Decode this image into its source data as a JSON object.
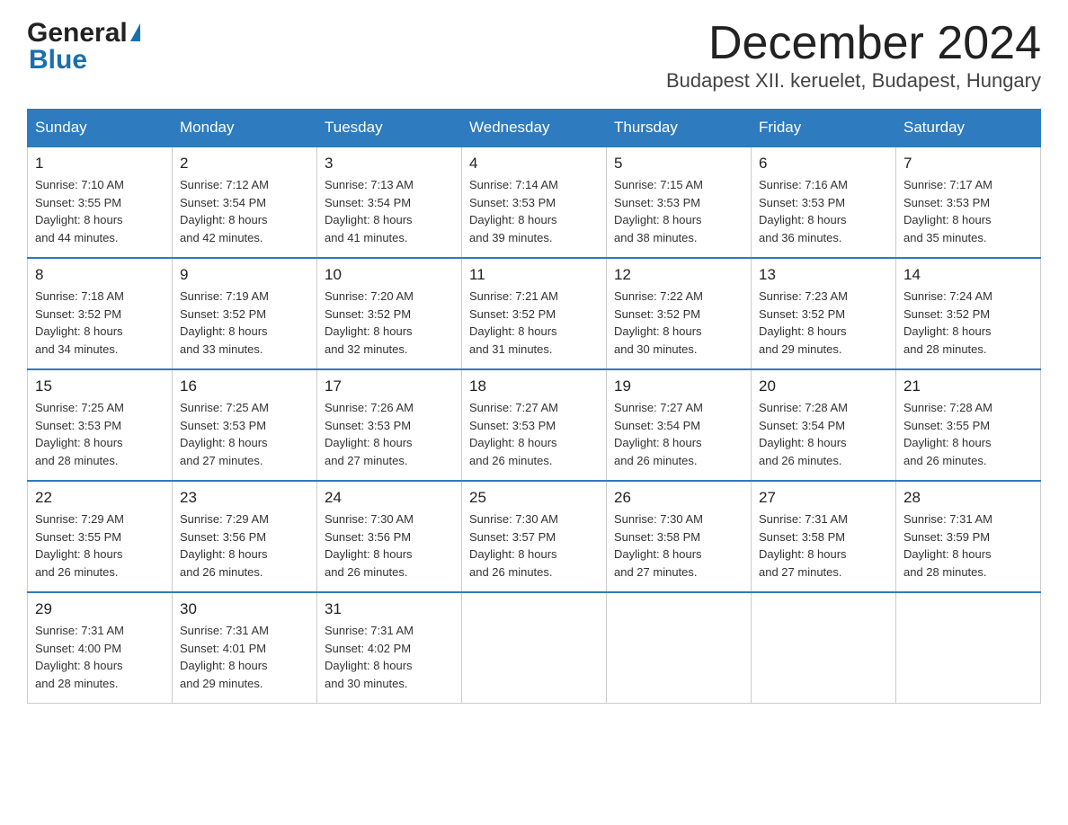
{
  "header": {
    "logo_general": "General",
    "logo_blue": "Blue",
    "month_title": "December 2024",
    "location": "Budapest XII. keruelet, Budapest, Hungary"
  },
  "days_of_week": [
    "Sunday",
    "Monday",
    "Tuesday",
    "Wednesday",
    "Thursday",
    "Friday",
    "Saturday"
  ],
  "weeks": [
    [
      {
        "num": "1",
        "sunrise": "7:10 AM",
        "sunset": "3:55 PM",
        "daylight": "8 hours and 44 minutes."
      },
      {
        "num": "2",
        "sunrise": "7:12 AM",
        "sunset": "3:54 PM",
        "daylight": "8 hours and 42 minutes."
      },
      {
        "num": "3",
        "sunrise": "7:13 AM",
        "sunset": "3:54 PM",
        "daylight": "8 hours and 41 minutes."
      },
      {
        "num": "4",
        "sunrise": "7:14 AM",
        "sunset": "3:53 PM",
        "daylight": "8 hours and 39 minutes."
      },
      {
        "num": "5",
        "sunrise": "7:15 AM",
        "sunset": "3:53 PM",
        "daylight": "8 hours and 38 minutes."
      },
      {
        "num": "6",
        "sunrise": "7:16 AM",
        "sunset": "3:53 PM",
        "daylight": "8 hours and 36 minutes."
      },
      {
        "num": "7",
        "sunrise": "7:17 AM",
        "sunset": "3:53 PM",
        "daylight": "8 hours and 35 minutes."
      }
    ],
    [
      {
        "num": "8",
        "sunrise": "7:18 AM",
        "sunset": "3:52 PM",
        "daylight": "8 hours and 34 minutes."
      },
      {
        "num": "9",
        "sunrise": "7:19 AM",
        "sunset": "3:52 PM",
        "daylight": "8 hours and 33 minutes."
      },
      {
        "num": "10",
        "sunrise": "7:20 AM",
        "sunset": "3:52 PM",
        "daylight": "8 hours and 32 minutes."
      },
      {
        "num": "11",
        "sunrise": "7:21 AM",
        "sunset": "3:52 PM",
        "daylight": "8 hours and 31 minutes."
      },
      {
        "num": "12",
        "sunrise": "7:22 AM",
        "sunset": "3:52 PM",
        "daylight": "8 hours and 30 minutes."
      },
      {
        "num": "13",
        "sunrise": "7:23 AM",
        "sunset": "3:52 PM",
        "daylight": "8 hours and 29 minutes."
      },
      {
        "num": "14",
        "sunrise": "7:24 AM",
        "sunset": "3:52 PM",
        "daylight": "8 hours and 28 minutes."
      }
    ],
    [
      {
        "num": "15",
        "sunrise": "7:25 AM",
        "sunset": "3:53 PM",
        "daylight": "8 hours and 28 minutes."
      },
      {
        "num": "16",
        "sunrise": "7:25 AM",
        "sunset": "3:53 PM",
        "daylight": "8 hours and 27 minutes."
      },
      {
        "num": "17",
        "sunrise": "7:26 AM",
        "sunset": "3:53 PM",
        "daylight": "8 hours and 27 minutes."
      },
      {
        "num": "18",
        "sunrise": "7:27 AM",
        "sunset": "3:53 PM",
        "daylight": "8 hours and 26 minutes."
      },
      {
        "num": "19",
        "sunrise": "7:27 AM",
        "sunset": "3:54 PM",
        "daylight": "8 hours and 26 minutes."
      },
      {
        "num": "20",
        "sunrise": "7:28 AM",
        "sunset": "3:54 PM",
        "daylight": "8 hours and 26 minutes."
      },
      {
        "num": "21",
        "sunrise": "7:28 AM",
        "sunset": "3:55 PM",
        "daylight": "8 hours and 26 minutes."
      }
    ],
    [
      {
        "num": "22",
        "sunrise": "7:29 AM",
        "sunset": "3:55 PM",
        "daylight": "8 hours and 26 minutes."
      },
      {
        "num": "23",
        "sunrise": "7:29 AM",
        "sunset": "3:56 PM",
        "daylight": "8 hours and 26 minutes."
      },
      {
        "num": "24",
        "sunrise": "7:30 AM",
        "sunset": "3:56 PM",
        "daylight": "8 hours and 26 minutes."
      },
      {
        "num": "25",
        "sunrise": "7:30 AM",
        "sunset": "3:57 PM",
        "daylight": "8 hours and 26 minutes."
      },
      {
        "num": "26",
        "sunrise": "7:30 AM",
        "sunset": "3:58 PM",
        "daylight": "8 hours and 27 minutes."
      },
      {
        "num": "27",
        "sunrise": "7:31 AM",
        "sunset": "3:58 PM",
        "daylight": "8 hours and 27 minutes."
      },
      {
        "num": "28",
        "sunrise": "7:31 AM",
        "sunset": "3:59 PM",
        "daylight": "8 hours and 28 minutes."
      }
    ],
    [
      {
        "num": "29",
        "sunrise": "7:31 AM",
        "sunset": "4:00 PM",
        "daylight": "8 hours and 28 minutes."
      },
      {
        "num": "30",
        "sunrise": "7:31 AM",
        "sunset": "4:01 PM",
        "daylight": "8 hours and 29 minutes."
      },
      {
        "num": "31",
        "sunrise": "7:31 AM",
        "sunset": "4:02 PM",
        "daylight": "8 hours and 30 minutes."
      },
      null,
      null,
      null,
      null
    ]
  ],
  "labels": {
    "sunrise": "Sunrise:",
    "sunset": "Sunset:",
    "daylight": "Daylight:"
  }
}
